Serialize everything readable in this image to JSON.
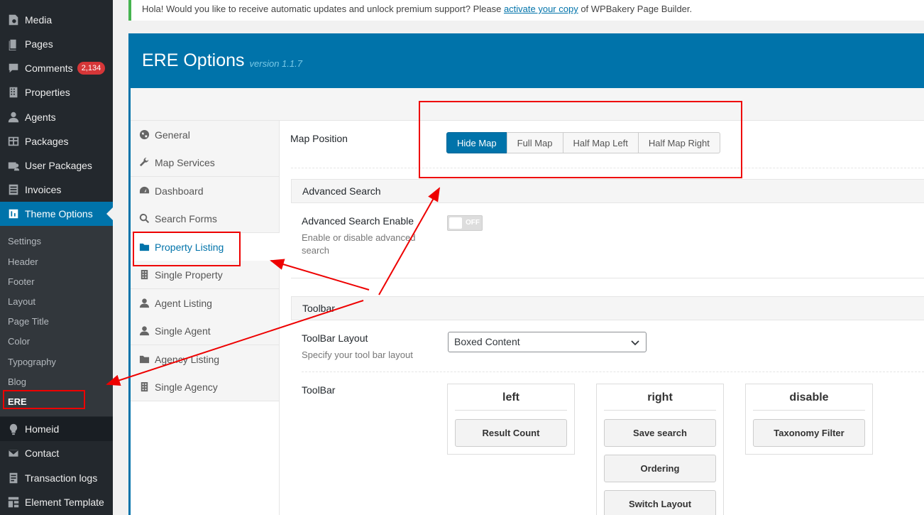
{
  "sidebar": {
    "items": [
      {
        "label": "Media",
        "icon": "media-icon"
      },
      {
        "label": "Pages",
        "icon": "pages-icon"
      },
      {
        "label": "Comments",
        "icon": "comments-icon",
        "badge": "2,134"
      },
      {
        "label": "Properties",
        "icon": "properties-icon"
      },
      {
        "label": "Agents",
        "icon": "agents-icon"
      },
      {
        "label": "Packages",
        "icon": "packages-icon"
      },
      {
        "label": "User Packages",
        "icon": "user-packages-icon"
      },
      {
        "label": "Invoices",
        "icon": "invoices-icon"
      },
      {
        "label": "Theme Options",
        "icon": "theme-options-icon"
      }
    ],
    "submenu": [
      "Settings",
      "Header",
      "Footer",
      "Layout",
      "Page Title",
      "Color",
      "Typography",
      "Blog",
      "ERE"
    ],
    "bottom_items": [
      {
        "label": "Homeid",
        "icon": "lightbulb-icon"
      },
      {
        "label": "Contact",
        "icon": "envelope-icon"
      },
      {
        "label": "Transaction logs",
        "icon": "transaction-logs-icon"
      },
      {
        "label": "Element Template",
        "icon": "element-template-icon"
      }
    ]
  },
  "notice": {
    "text_before": "Hola! Would you like to receive automatic updates and unlock premium support? Please ",
    "link": "activate your copy",
    "text_after": " of WPBakery Page Builder."
  },
  "ere": {
    "title": "ERE Options",
    "version": "version 1.1.7",
    "nav": [
      "General",
      "Map Services",
      "Dashboard",
      "Search Forms",
      "Property Listing",
      "Single Property",
      "Agent Listing",
      "Single Agent",
      "Agency Listing",
      "Single Agency"
    ],
    "map_position": {
      "label": "Map Position",
      "options": [
        "Hide Map",
        "Full Map",
        "Half Map Left",
        "Half Map Right"
      ],
      "selected": "Hide Map"
    },
    "advanced_search": {
      "section_title": "Advanced Search",
      "label": "Advanced Search Enable",
      "desc_line1": "Enable or disable advanced",
      "desc_line2": "search",
      "toggle": "OFF"
    },
    "toolbar": {
      "section_title": "Toolbar",
      "layout_label": "ToolBar Layout",
      "layout_desc": "Specify your tool bar layout",
      "layout_value": "Boxed Content",
      "sorter_label": "ToolBar",
      "columns": [
        {
          "title": "left",
          "items": [
            "Result Count"
          ]
        },
        {
          "title": "right",
          "items": [
            "Save search",
            "Ordering",
            "Switch Layout"
          ]
        },
        {
          "title": "disable",
          "items": [
            "Taxonomy Filter"
          ]
        }
      ]
    }
  },
  "colors": {
    "wp_sidebar": "#23282d",
    "accent_blue": "#0073aa",
    "annotation_red": "#e00000"
  }
}
